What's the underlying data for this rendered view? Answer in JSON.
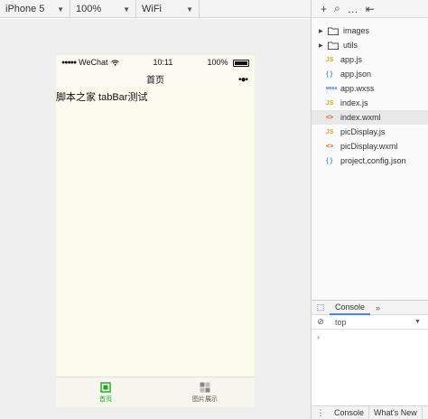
{
  "device_bar": {
    "device": "iPhone 5",
    "zoom": "100%",
    "network": "WiFi"
  },
  "phone": {
    "status": {
      "signal": "●●●●●",
      "carrier": "WeChat",
      "time": "10:11",
      "battery": "100%"
    },
    "nav_title": "首页",
    "capsule": "•●•",
    "content_text": "脚本之家 tabBar测试",
    "tabs": [
      {
        "label": "首页",
        "active": true
      },
      {
        "label": "图片展示",
        "active": false
      }
    ]
  },
  "file_tree": {
    "toolbar": {
      "add": "+",
      "search": "⌕",
      "more": "…",
      "collapse": "⇤"
    },
    "items": [
      {
        "type": "folder",
        "icon": "folder",
        "label": "images"
      },
      {
        "type": "folder",
        "icon": "folder",
        "label": "utils"
      },
      {
        "type": "file",
        "icon": "JS",
        "label": "app.js"
      },
      {
        "type": "file",
        "icon": "{ }",
        "label": "app.json"
      },
      {
        "type": "file",
        "icon": "wxss",
        "label": "app.wxss"
      },
      {
        "type": "file",
        "icon": "JS",
        "label": "index.js"
      },
      {
        "type": "file",
        "icon": "<>",
        "label": "index.wxml"
      },
      {
        "type": "file",
        "icon": "JS",
        "label": "picDisplay.js"
      },
      {
        "type": "file",
        "icon": "<>",
        "label": "picDisplay.wxml"
      },
      {
        "type": "file",
        "icon": "{ }",
        "label": "project.config.json"
      }
    ],
    "selected_index": 6
  },
  "console": {
    "tab_label": "Console",
    "more": "»",
    "context": "top",
    "prompt": "›",
    "drawer_menu": "⋮",
    "drawer_tabs": [
      "Console",
      "What's New"
    ]
  },
  "colors": {
    "phone_bg": "#fbfbed",
    "tab_active": "#1aad19",
    "js_icon": "#e8a82c",
    "json_icon": "#4a90d9",
    "wxml_icon": "#e0622a"
  }
}
